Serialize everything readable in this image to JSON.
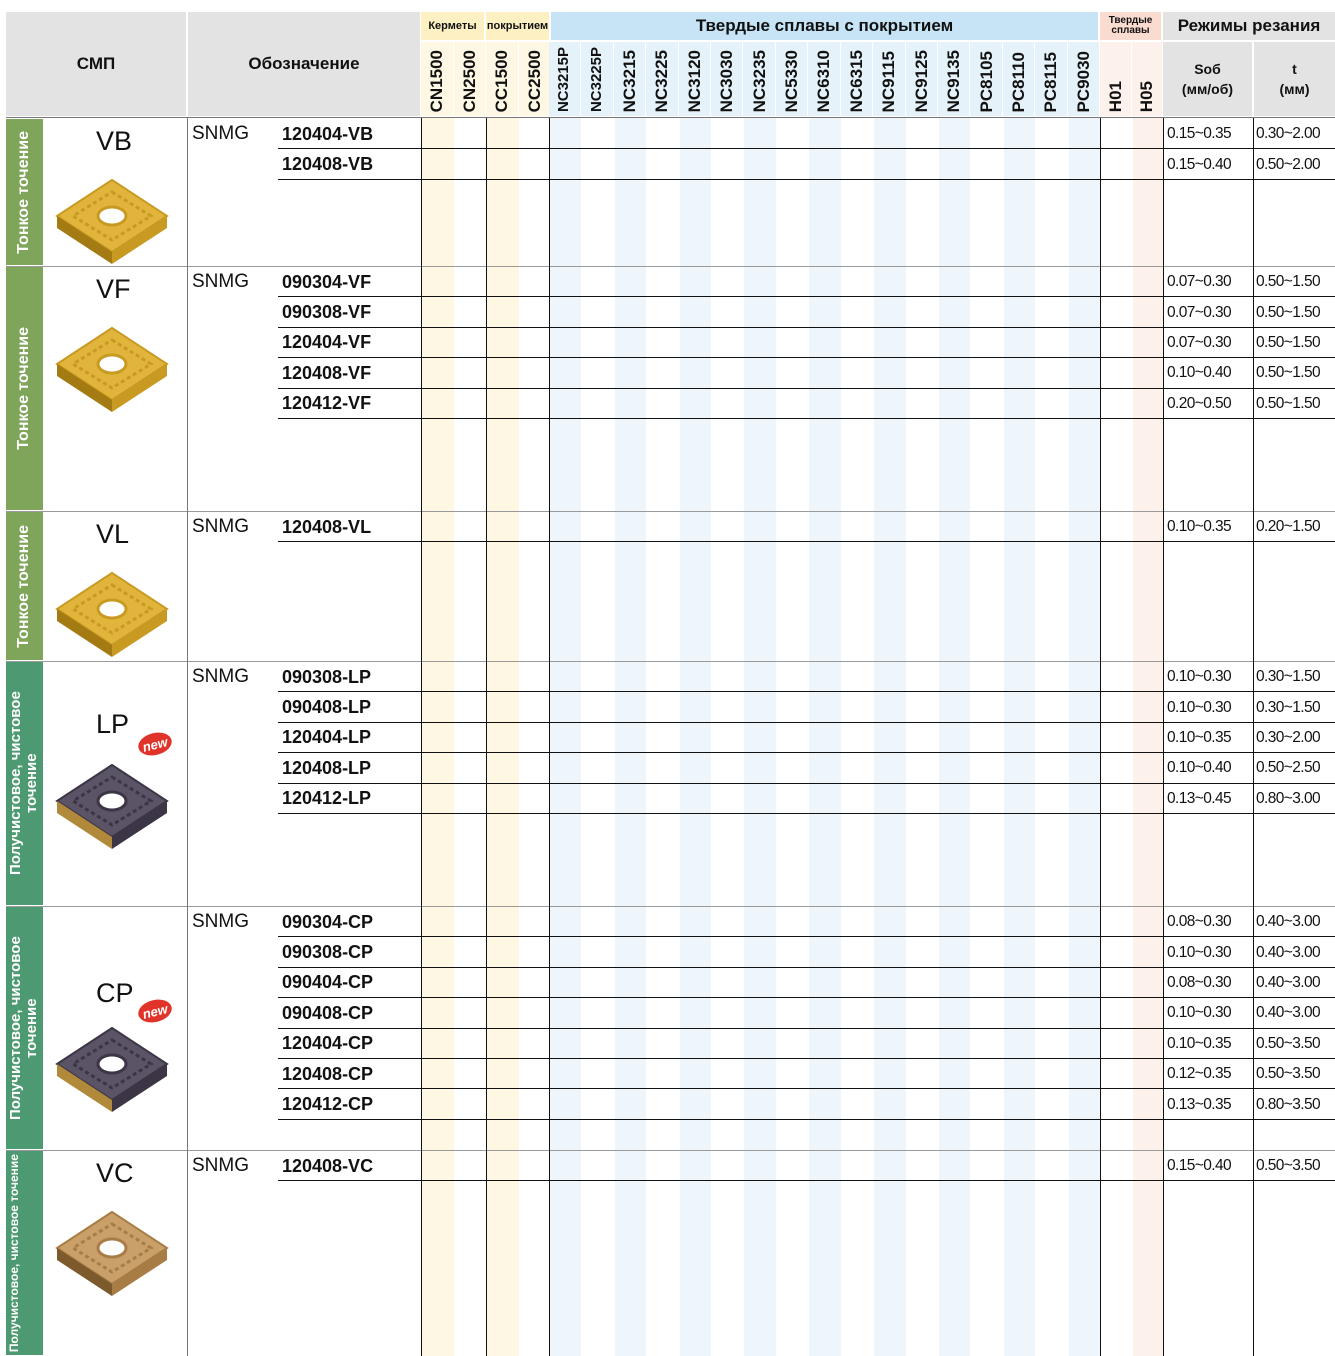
{
  "header": {
    "smp": "СМП",
    "designation": "Обозначение",
    "cermets": "Керметы",
    "coated": "покрытием",
    "coated_carbides": "Твердые сплавы с покрытием",
    "carbides": "Твердые сплавы",
    "modes": "Режимы резания",
    "feed": "Sоб",
    "feed_unit": "(мм/об)",
    "depth": "t",
    "depth_unit": "(мм)"
  },
  "grades": [
    "CN1500",
    "CN2500",
    "CC1500",
    "CC2500",
    "NC3215P",
    "NC3225P",
    "NC3215",
    "NC3225",
    "NC3120",
    "NC3030",
    "NC3235",
    "NC5330",
    "NC6310",
    "NC6315",
    "NC9115",
    "NC9125",
    "NC9135",
    "PC8105",
    "PC8110",
    "PC8115",
    "PC9030",
    "H01",
    "H05"
  ],
  "colors": {
    "header_bg": "#e3e3e3",
    "cermet": "#fdf0c3",
    "cermet_light": "#fef7e4",
    "coated": "#c7e4f6",
    "coated_light": "#eef5fb",
    "carbide": "#f9dccf",
    "carbide_light": "#fdf1ec",
    "band_green": "#7fa55b",
    "band_teal": "#4d9a72",
    "new_badge": "#e0342a"
  },
  "groups": [
    {
      "band": "Тонкое точение",
      "chipbreaker": "VB",
      "icon": "insert-gold-icon",
      "is_new": false,
      "prefix": "SNMG",
      "rows": [
        {
          "code": "120404-VB",
          "feed": "0.15~0.35",
          "depth": "0.30~2.00"
        },
        {
          "code": "120408-VB",
          "feed": "0.15~0.40",
          "depth": "0.50~2.00"
        }
      ]
    },
    {
      "band": "Тонкое точение",
      "chipbreaker": "VF",
      "icon": "insert-gold-icon",
      "is_new": false,
      "prefix": "SNMG",
      "rows": [
        {
          "code": "090304-VF",
          "feed": "0.07~0.30",
          "depth": "0.50~1.50"
        },
        {
          "code": "090308-VF",
          "feed": "0.07~0.30",
          "depth": "0.50~1.50"
        },
        {
          "code": "120404-VF",
          "feed": "0.07~0.30",
          "depth": "0.50~1.50"
        },
        {
          "code": "120408-VF",
          "feed": "0.10~0.40",
          "depth": "0.50~1.50"
        },
        {
          "code": "120412-VF",
          "feed": "0.20~0.50",
          "depth": "0.50~1.50"
        }
      ]
    },
    {
      "band": "Тонкое точение",
      "chipbreaker": "VL",
      "icon": "insert-gold-icon",
      "is_new": false,
      "prefix": "SNMG",
      "rows": [
        {
          "code": "120408-VL",
          "feed": "0.10~0.35",
          "depth": "0.20~1.50"
        }
      ]
    },
    {
      "band": "Получистовое, чистовое точение",
      "chipbreaker": "LP",
      "icon": "insert-dark-icon",
      "is_new": true,
      "new_label": "new",
      "prefix": "SNMG",
      "rows": [
        {
          "code": "090308-LP",
          "feed": "0.10~0.30",
          "depth": "0.30~1.50"
        },
        {
          "code": "090408-LP",
          "feed": "0.10~0.30",
          "depth": "0.30~1.50"
        },
        {
          "code": "120404-LP",
          "feed": "0.10~0.35",
          "depth": "0.30~2.00"
        },
        {
          "code": "120408-LP",
          "feed": "0.10~0.40",
          "depth": "0.50~2.50"
        },
        {
          "code": "120412-LP",
          "feed": "0.13~0.45",
          "depth": "0.80~3.00"
        }
      ]
    },
    {
      "band": "Получистовое, чистовое точение",
      "chipbreaker": "CP",
      "icon": "insert-dark-icon",
      "is_new": true,
      "new_label": "new",
      "prefix": "SNMG",
      "rows": [
        {
          "code": "090304-CP",
          "feed": "0.08~0.30",
          "depth": "0.40~3.00"
        },
        {
          "code": "090308-CP",
          "feed": "0.10~0.30",
          "depth": "0.40~3.00"
        },
        {
          "code": "090404-CP",
          "feed": "0.08~0.30",
          "depth": "0.40~3.00"
        },
        {
          "code": "090408-CP",
          "feed": "0.10~0.30",
          "depth": "0.40~3.00"
        },
        {
          "code": "120404-CP",
          "feed": "0.10~0.35",
          "depth": "0.50~3.50"
        },
        {
          "code": "120408-CP",
          "feed": "0.12~0.35",
          "depth": "0.50~3.50"
        },
        {
          "code": "120412-CP",
          "feed": "0.13~0.35",
          "depth": "0.80~3.50"
        }
      ]
    },
    {
      "band": "Получистовое, чистовое точение",
      "chipbreaker": "VC",
      "icon": "insert-bronze-icon",
      "is_new": false,
      "prefix": "SNMG",
      "rows": [
        {
          "code": "120408-VC",
          "feed": "0.15~0.40",
          "depth": "0.50~3.50"
        }
      ]
    }
  ]
}
